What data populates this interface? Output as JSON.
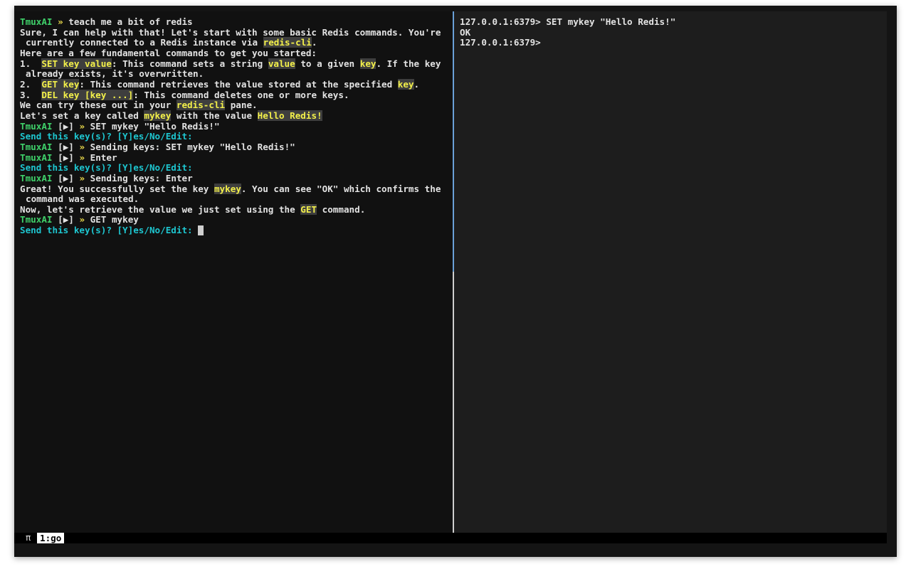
{
  "left_pane": {
    "lines": [
      {
        "indent": false,
        "segments": [
          {
            "t": "TmuxAI",
            "c": "green"
          },
          {
            "t": " » ",
            "c": "yellow-text"
          },
          {
            "t": "teach me a bit of redis"
          }
        ]
      },
      {
        "indent": false,
        "segments": [
          {
            "t": "Sure, I can help with that! Let's start with some basic Redis commands. You're"
          }
        ]
      },
      {
        "indent": true,
        "segments": [
          {
            "t": "currently connected to a Redis instance via "
          },
          {
            "t": "redis-cli",
            "c": "hl"
          },
          {
            "t": "."
          }
        ]
      },
      {
        "indent": false,
        "segments": [
          {
            "t": "Here are a few fundamental commands to get you started:"
          }
        ]
      },
      {
        "indent": false,
        "segments": [
          {
            "t": "1.  "
          },
          {
            "t": "SET key value",
            "c": "hl"
          },
          {
            "t": ": This command sets a string "
          },
          {
            "t": "value",
            "c": "hl"
          },
          {
            "t": " to a given "
          },
          {
            "t": "key",
            "c": "hl"
          },
          {
            "t": ". If the key"
          }
        ]
      },
      {
        "indent": true,
        "segments": [
          {
            "t": "already exists, it's overwritten."
          }
        ]
      },
      {
        "indent": false,
        "segments": [
          {
            "t": "2.  "
          },
          {
            "t": "GET key",
            "c": "hl"
          },
          {
            "t": ": This command retrieves the value stored at the specified "
          },
          {
            "t": "key",
            "c": "hl"
          },
          {
            "t": "."
          }
        ]
      },
      {
        "indent": false,
        "segments": [
          {
            "t": "3.  "
          },
          {
            "t": "DEL key [key ...]",
            "c": "hl"
          },
          {
            "t": ": This command deletes one or more keys."
          }
        ]
      },
      {
        "indent": false,
        "segments": [
          {
            "t": "We can try these out in your "
          },
          {
            "t": "redis-cli",
            "c": "hl"
          },
          {
            "t": " pane."
          }
        ]
      },
      {
        "indent": false,
        "segments": [
          {
            "t": "Let's set a key called "
          },
          {
            "t": "mykey",
            "c": "hl"
          },
          {
            "t": " with the value "
          },
          {
            "t": "Hello Redis!",
            "c": "hl"
          }
        ]
      },
      {
        "indent": false,
        "segments": [
          {
            "t": "TmuxAI",
            "c": "green"
          },
          {
            "t": " "
          },
          {
            "t": "[",
            "c": "box-open"
          },
          {
            "t": "▶",
            "c": "box"
          },
          {
            "t": "]",
            "c": "box-close"
          },
          {
            "t": " » ",
            "c": "yellow-text"
          },
          {
            "t": "SET mykey \"Hello Redis!\""
          }
        ]
      },
      {
        "indent": false,
        "segments": [
          {
            "t": "Send this key(s)? [Y]es/No/Edit:",
            "c": "cyan"
          }
        ]
      },
      {
        "indent": false,
        "segments": [
          {
            "t": "TmuxAI",
            "c": "green"
          },
          {
            "t": " "
          },
          {
            "t": "[",
            "c": "box-open"
          },
          {
            "t": "▶",
            "c": "box"
          },
          {
            "t": "]",
            "c": "box-close"
          },
          {
            "t": " » ",
            "c": "yellow-text"
          },
          {
            "t": "Sending keys: SET mykey \"Hello Redis!\""
          }
        ]
      },
      {
        "indent": false,
        "segments": [
          {
            "t": "TmuxAI",
            "c": "green"
          },
          {
            "t": " "
          },
          {
            "t": "[",
            "c": "box-open"
          },
          {
            "t": "▶",
            "c": "box"
          },
          {
            "t": "]",
            "c": "box-close"
          },
          {
            "t": " » ",
            "c": "yellow-text"
          },
          {
            "t": "Enter"
          }
        ]
      },
      {
        "indent": false,
        "segments": [
          {
            "t": "Send this key(s)? [Y]es/No/Edit:",
            "c": "cyan"
          }
        ]
      },
      {
        "indent": false,
        "segments": [
          {
            "t": "TmuxAI",
            "c": "green"
          },
          {
            "t": " "
          },
          {
            "t": "[",
            "c": "box-open"
          },
          {
            "t": "▶",
            "c": "box"
          },
          {
            "t": "]",
            "c": "box-close"
          },
          {
            "t": " » ",
            "c": "yellow-text"
          },
          {
            "t": "Sending keys: Enter"
          }
        ]
      },
      {
        "indent": false,
        "segments": [
          {
            "t": "Great! You successfully set the key "
          },
          {
            "t": "mykey",
            "c": "hl"
          },
          {
            "t": ". You can see \"OK\" which confirms the"
          }
        ]
      },
      {
        "indent": true,
        "segments": [
          {
            "t": "command was executed."
          }
        ]
      },
      {
        "indent": false,
        "segments": [
          {
            "t": "Now, let's retrieve the value we just set using the "
          },
          {
            "t": "GET",
            "c": "hl"
          },
          {
            "t": " command."
          }
        ]
      },
      {
        "indent": false,
        "segments": [
          {
            "t": "TmuxAI",
            "c": "green"
          },
          {
            "t": " "
          },
          {
            "t": "[",
            "c": "box-open"
          },
          {
            "t": "▶",
            "c": "box"
          },
          {
            "t": "]",
            "c": "box-close"
          },
          {
            "t": " » ",
            "c": "yellow-text"
          },
          {
            "t": "GET mykey"
          }
        ]
      },
      {
        "indent": false,
        "cursor": true,
        "segments": [
          {
            "t": "Send this key(s)? [Y]es/No/Edit: ",
            "c": "cyan"
          }
        ]
      }
    ]
  },
  "right_pane": {
    "lines": [
      "127.0.0.1:6379> SET mykey \"Hello Redis!\"",
      "OK",
      "127.0.0.1:6379>"
    ]
  },
  "status_bar": {
    "session_icon": "π",
    "window_label": "1:go"
  },
  "colors": {
    "prompt_green": "#3fd16a",
    "question_cyan": "#1ec6d0",
    "highlight_yellow": "#f3f04a",
    "highlight_bg": "#3e3e3e"
  },
  "icons": {
    "play_icon": "play-triangle-icon",
    "cursor": "block-cursor"
  }
}
